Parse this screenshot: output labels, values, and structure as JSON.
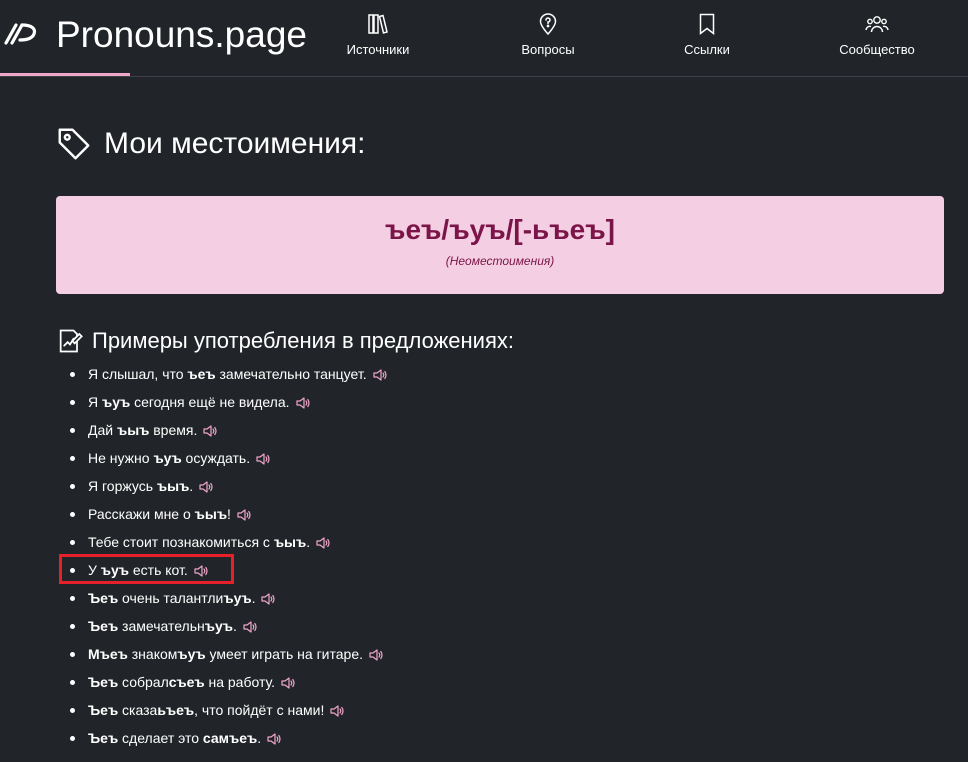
{
  "header": {
    "title": "Pronouns.page",
    "nav": [
      {
        "label": "Источники",
        "icon": "books-icon"
      },
      {
        "label": "Вопросы",
        "icon": "map-pin-question-icon"
      },
      {
        "label": "Ссылки",
        "icon": "bookmark-icon"
      },
      {
        "label": "Сообщество",
        "icon": "users-icon"
      }
    ]
  },
  "main": {
    "heading": "Мои местоимения:",
    "pronoun": "ъеъ/ъуъ/[-ьъеъ]",
    "pronoun_note": "(Неоместоимения)",
    "examples_heading": "Примеры употребления в предложениях:",
    "examples": [
      {
        "parts": [
          "Я слышал, что ",
          "ъеъ",
          " замечательно танцует."
        ]
      },
      {
        "parts": [
          "Я ",
          "ъуъ",
          " сегодня ещё не видела."
        ]
      },
      {
        "parts": [
          "Дай ",
          "ъыъ",
          " время."
        ]
      },
      {
        "parts": [
          "Не нужно ",
          "ъуъ",
          " осуждать."
        ]
      },
      {
        "parts": [
          "Я горжусь ",
          "ъыъ",
          "."
        ]
      },
      {
        "parts": [
          "Расскажи мне о ",
          "ъыъ",
          "!"
        ]
      },
      {
        "parts": [
          "Тебе стоит познакомиться с ",
          "ъыъ",
          "."
        ]
      },
      {
        "parts": [
          "У ",
          "ъуъ",
          " есть кот."
        ]
      },
      {
        "parts": [
          "",
          "Ъеъ",
          " очень талантли",
          "ъуъ",
          "."
        ]
      },
      {
        "parts": [
          "",
          "Ъеъ",
          " замечательн",
          "ъуъ",
          "."
        ]
      },
      {
        "parts": [
          "",
          "Мъеъ",
          " знаком",
          "ъуъ",
          " умеет играть на гитаре."
        ]
      },
      {
        "parts": [
          "",
          "Ъеъ",
          " собрал",
          "съеъ",
          " на работу."
        ]
      },
      {
        "parts": [
          "",
          "Ъеъ",
          " сказа",
          "ьъеъ",
          ", что пойдёт с нами!"
        ]
      },
      {
        "parts": [
          "",
          "Ъеъ",
          " сделает это ",
          "самъеъ",
          "."
        ]
      }
    ]
  },
  "colors": {
    "background": "#212529",
    "accent": "#f0a6c8",
    "card_bg": "#f4cfe3",
    "card_text": "#7b1448",
    "highlight": "#e8202a"
  }
}
